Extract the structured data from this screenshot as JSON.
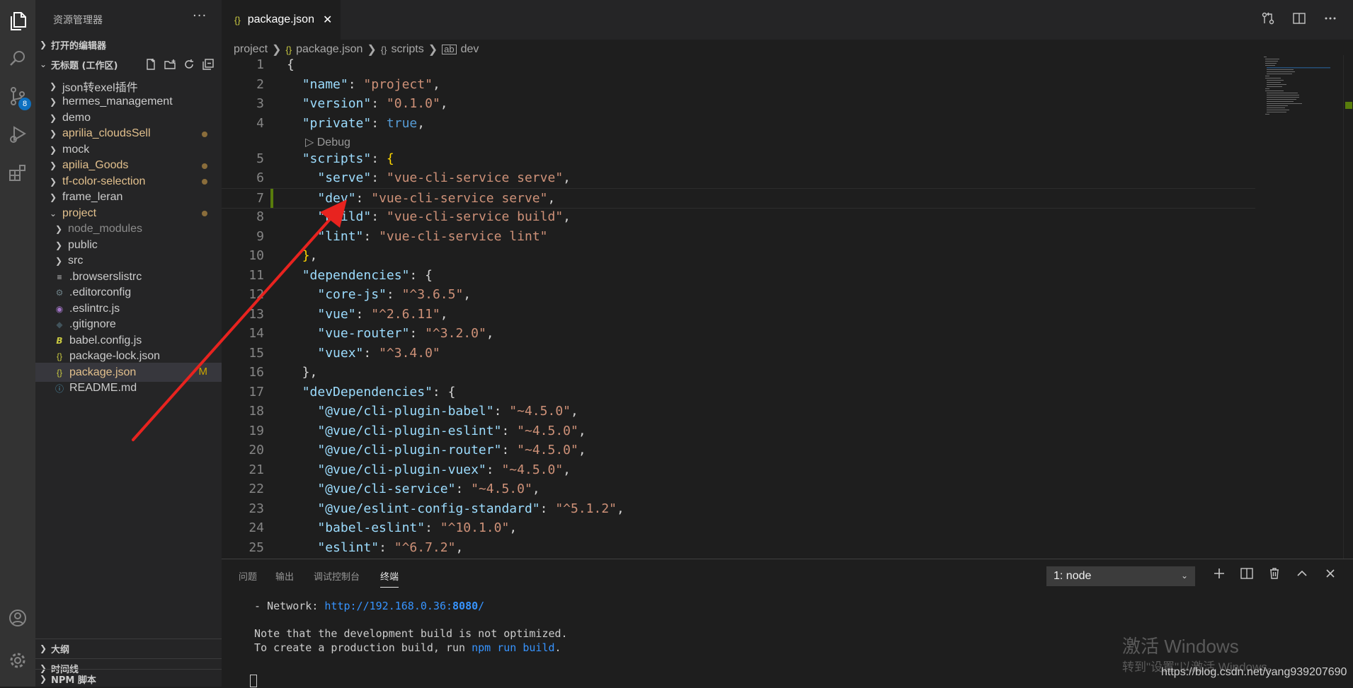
{
  "sidebar": {
    "title": "资源管理器",
    "more": "···",
    "open_editors": "打开的编辑器",
    "workspace": "无标题 (工作区)",
    "tree": [
      {
        "label": "json转exel插件",
        "kind": "folder",
        "color": "#cccccc",
        "dot": false,
        "mod": ""
      },
      {
        "label": "hermes_management",
        "kind": "folder",
        "color": "#cccccc",
        "dot": false,
        "mod": ""
      },
      {
        "label": "demo",
        "kind": "folder",
        "color": "#cccccc",
        "dot": false,
        "mod": ""
      },
      {
        "label": "aprilia_cloudsSell",
        "kind": "folder",
        "color": "#e2c08d",
        "dot": true,
        "mod": ""
      },
      {
        "label": "mock",
        "kind": "folder",
        "color": "#cccccc",
        "dot": false,
        "mod": ""
      },
      {
        "label": "apilia_Goods",
        "kind": "folder",
        "color": "#e2c08d",
        "dot": true,
        "mod": ""
      },
      {
        "label": "tf-color-selection",
        "kind": "folder",
        "color": "#e2c08d",
        "dot": true,
        "mod": ""
      },
      {
        "label": "frame_leran",
        "kind": "folder",
        "color": "#cccccc",
        "dot": false,
        "mod": ""
      },
      {
        "label": "project",
        "kind": "folder-open",
        "color": "#e2c08d",
        "dot": true,
        "mod": ""
      },
      {
        "label": "node_modules",
        "kind": "subfolder",
        "color": "#8c8c8c",
        "dot": false,
        "mod": ""
      },
      {
        "label": "public",
        "kind": "subfolder",
        "color": "#cccccc",
        "dot": false,
        "mod": ""
      },
      {
        "label": "src",
        "kind": "subfolder",
        "color": "#cccccc",
        "dot": false,
        "mod": ""
      },
      {
        "label": ".browserslistrc",
        "kind": "file",
        "icon": "lines-icon",
        "color": "#cccccc",
        "dot": false,
        "mod": ""
      },
      {
        "label": ".editorconfig",
        "kind": "file",
        "icon": "gear-icon",
        "color": "#cccccc",
        "dot": false,
        "mod": ""
      },
      {
        "label": ".eslintrc.js",
        "kind": "file",
        "icon": "eslint-icon",
        "color": "#cccccc",
        "dot": false,
        "mod": ""
      },
      {
        "label": ".gitignore",
        "kind": "file",
        "icon": "git-icon",
        "color": "#cccccc",
        "dot": false,
        "mod": ""
      },
      {
        "label": "babel.config.js",
        "kind": "file",
        "icon": "babel-icon",
        "color": "#cccccc",
        "dot": false,
        "mod": ""
      },
      {
        "label": "package-lock.json",
        "kind": "file",
        "icon": "json-icon",
        "color": "#cccccc",
        "dot": false,
        "mod": ""
      },
      {
        "label": "package.json",
        "kind": "file",
        "icon": "json-icon",
        "color": "#e2c08d",
        "dot": false,
        "mod": "M",
        "selected": true
      },
      {
        "label": "README.md",
        "kind": "file",
        "icon": "info-icon",
        "color": "#cccccc",
        "dot": false,
        "mod": ""
      }
    ],
    "outline": "大纲",
    "timeline": "时间线",
    "npm": "NPM 脚本"
  },
  "activity": {
    "scm_badge": "8"
  },
  "tab": {
    "title": "package.json",
    "icon": "{}",
    "close": "✕"
  },
  "breadcrumb": [
    "project",
    "package.json",
    "scripts",
    "dev"
  ],
  "codelens": "Debug",
  "code": [
    {
      "n": "1",
      "t": [
        [
          "p",
          "{"
        ]
      ]
    },
    {
      "n": "2",
      "t": [
        [
          "p",
          "  "
        ],
        [
          "k",
          "\"name\""
        ],
        [
          "p",
          ": "
        ],
        [
          "s",
          "\"project\""
        ],
        [
          "p",
          ","
        ]
      ]
    },
    {
      "n": "3",
      "t": [
        [
          "p",
          "  "
        ],
        [
          "k",
          "\"version\""
        ],
        [
          "p",
          ": "
        ],
        [
          "s",
          "\"0.1.0\""
        ],
        [
          "p",
          ","
        ]
      ]
    },
    {
      "n": "4",
      "t": [
        [
          "p",
          "  "
        ],
        [
          "k",
          "\"private\""
        ],
        [
          "p",
          ": "
        ],
        [
          "b",
          "true"
        ],
        [
          "p",
          ","
        ]
      ]
    },
    {
      "n": "5",
      "t": [
        [
          "p",
          "  "
        ],
        [
          "k",
          "\"scripts\""
        ],
        [
          "p",
          ": "
        ],
        [
          "y",
          "{"
        ]
      ]
    },
    {
      "n": "6",
      "t": [
        [
          "p",
          "    "
        ],
        [
          "k",
          "\"serve\""
        ],
        [
          "p",
          ": "
        ],
        [
          "s",
          "\"vue-cli-service serve\""
        ],
        [
          "p",
          ","
        ]
      ]
    },
    {
      "n": "7",
      "t": [
        [
          "p",
          "    "
        ],
        [
          "k",
          "\"dev\""
        ],
        [
          "p",
          ": "
        ],
        [
          "s",
          "\"vue-cli-service serve\""
        ],
        [
          "p",
          ","
        ]
      ]
    },
    {
      "n": "8",
      "t": [
        [
          "p",
          "    "
        ],
        [
          "k",
          "\"build\""
        ],
        [
          "p",
          ": "
        ],
        [
          "s",
          "\"vue-cli-service build\""
        ],
        [
          "p",
          ","
        ]
      ]
    },
    {
      "n": "9",
      "t": [
        [
          "p",
          "    "
        ],
        [
          "k",
          "\"lint\""
        ],
        [
          "p",
          ": "
        ],
        [
          "s",
          "\"vue-cli-service lint\""
        ]
      ]
    },
    {
      "n": "10",
      "t": [
        [
          "p",
          "  "
        ],
        [
          "y",
          "}"
        ],
        [
          "p",
          ","
        ]
      ]
    },
    {
      "n": "11",
      "t": [
        [
          "p",
          "  "
        ],
        [
          "k",
          "\"dependencies\""
        ],
        [
          "p",
          ": {"
        ]
      ]
    },
    {
      "n": "12",
      "t": [
        [
          "p",
          "    "
        ],
        [
          "k",
          "\"core-js\""
        ],
        [
          "p",
          ": "
        ],
        [
          "s",
          "\"^3.6.5\""
        ],
        [
          "p",
          ","
        ]
      ]
    },
    {
      "n": "13",
      "t": [
        [
          "p",
          "    "
        ],
        [
          "k",
          "\"vue\""
        ],
        [
          "p",
          ": "
        ],
        [
          "s",
          "\"^2.6.11\""
        ],
        [
          "p",
          ","
        ]
      ]
    },
    {
      "n": "14",
      "t": [
        [
          "p",
          "    "
        ],
        [
          "k",
          "\"vue-router\""
        ],
        [
          "p",
          ": "
        ],
        [
          "s",
          "\"^3.2.0\""
        ],
        [
          "p",
          ","
        ]
      ]
    },
    {
      "n": "15",
      "t": [
        [
          "p",
          "    "
        ],
        [
          "k",
          "\"vuex\""
        ],
        [
          "p",
          ": "
        ],
        [
          "s",
          "\"^3.4.0\""
        ]
      ]
    },
    {
      "n": "16",
      "t": [
        [
          "p",
          "  },"
        ]
      ]
    },
    {
      "n": "17",
      "t": [
        [
          "p",
          "  "
        ],
        [
          "k",
          "\"devDependencies\""
        ],
        [
          "p",
          ": {"
        ]
      ]
    },
    {
      "n": "18",
      "t": [
        [
          "p",
          "    "
        ],
        [
          "k",
          "\"@vue/cli-plugin-babel\""
        ],
        [
          "p",
          ": "
        ],
        [
          "s",
          "\"~4.5.0\""
        ],
        [
          "p",
          ","
        ]
      ]
    },
    {
      "n": "19",
      "t": [
        [
          "p",
          "    "
        ],
        [
          "k",
          "\"@vue/cli-plugin-eslint\""
        ],
        [
          "p",
          ": "
        ],
        [
          "s",
          "\"~4.5.0\""
        ],
        [
          "p",
          ","
        ]
      ]
    },
    {
      "n": "20",
      "t": [
        [
          "p",
          "    "
        ],
        [
          "k",
          "\"@vue/cli-plugin-router\""
        ],
        [
          "p",
          ": "
        ],
        [
          "s",
          "\"~4.5.0\""
        ],
        [
          "p",
          ","
        ]
      ]
    },
    {
      "n": "21",
      "t": [
        [
          "p",
          "    "
        ],
        [
          "k",
          "\"@vue/cli-plugin-vuex\""
        ],
        [
          "p",
          ": "
        ],
        [
          "s",
          "\"~4.5.0\""
        ],
        [
          "p",
          ","
        ]
      ]
    },
    {
      "n": "22",
      "t": [
        [
          "p",
          "    "
        ],
        [
          "k",
          "\"@vue/cli-service\""
        ],
        [
          "p",
          ": "
        ],
        [
          "s",
          "\"~4.5.0\""
        ],
        [
          "p",
          ","
        ]
      ]
    },
    {
      "n": "23",
      "t": [
        [
          "p",
          "    "
        ],
        [
          "k",
          "\"@vue/eslint-config-standard\""
        ],
        [
          "p",
          ": "
        ],
        [
          "s",
          "\"^5.1.2\""
        ],
        [
          "p",
          ","
        ]
      ]
    },
    {
      "n": "24",
      "t": [
        [
          "p",
          "    "
        ],
        [
          "k",
          "\"babel-eslint\""
        ],
        [
          "p",
          ": "
        ],
        [
          "s",
          "\"^10.1.0\""
        ],
        [
          "p",
          ","
        ]
      ]
    },
    {
      "n": "25",
      "t": [
        [
          "p",
          "    "
        ],
        [
          "k",
          "\"eslint\""
        ],
        [
          "p",
          ": "
        ],
        [
          "s",
          "\"^6.7.2\""
        ],
        [
          "p",
          ","
        ]
      ]
    }
  ],
  "panel": {
    "tabs": [
      "问题",
      "输出",
      "调试控制台",
      "终端"
    ],
    "select": "1: node",
    "terminal": {
      "network_prefix": "  - Network: ",
      "network_url": "http://192.168.0.36:",
      "network_port": "8080",
      "network_suffix": "/",
      "note": "  Note that the development build is not optimized.",
      "create_prefix": "  To create a production build, run ",
      "create_cmd": "npm run build",
      "create_suffix": "."
    }
  },
  "watermark": {
    "activate": "激活 Windows",
    "goto": "转到\"设置\"以激活 Windows。",
    "url": "https://blog.csdn.net/yang939207690"
  },
  "colors": {
    "arrow": "#e8231f",
    "accent": "#0e70c0",
    "modified": "#cca700"
  }
}
